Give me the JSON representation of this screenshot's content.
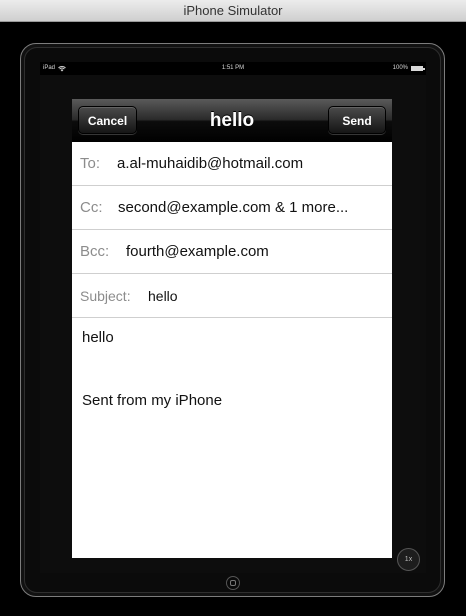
{
  "window": {
    "title": "iPhone Simulator"
  },
  "statusbar": {
    "carrier": "iPad",
    "time": "1:51 PM",
    "battery": "100%",
    "battery_level": 1.0
  },
  "compose": {
    "title": "hello",
    "cancel_label": "Cancel",
    "send_label": "Send",
    "to": {
      "label": "To:",
      "value": "a.al-muhaidib@hotmail.com"
    },
    "cc": {
      "label": "Cc:",
      "value": "second@example.com & 1 more..."
    },
    "bcc": {
      "label": "Bcc:",
      "value": "fourth@example.com"
    },
    "subject": {
      "label": "Subject:",
      "value": "hello"
    },
    "body": {
      "text": "hello",
      "signature": "Sent from my iPhone"
    }
  },
  "simulator": {
    "zoom_label": "1x"
  }
}
